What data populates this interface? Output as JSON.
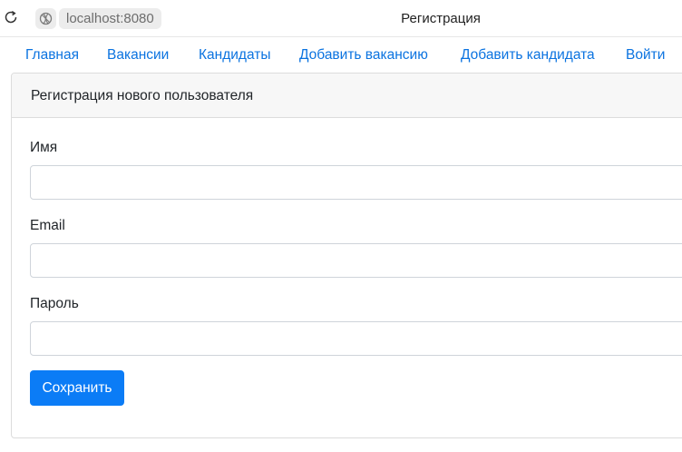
{
  "browser": {
    "url": "localhost:8080",
    "tab_title": "Регистрация"
  },
  "nav": {
    "items": [
      {
        "label": "Главная"
      },
      {
        "label": "Вакансии"
      },
      {
        "label": "Кандидаты"
      },
      {
        "label": "Добавить вакансию"
      },
      {
        "label": "Добавить кандидата"
      },
      {
        "label": "Войти"
      }
    ]
  },
  "form": {
    "title": "Регистрация нового пользователя",
    "fields": [
      {
        "label": "Имя",
        "value": ""
      },
      {
        "label": "Email",
        "value": ""
      },
      {
        "label": "Пароль",
        "value": ""
      }
    ],
    "submit_label": "Сохранить"
  },
  "colors": {
    "link": "#0b73e0",
    "primary_button": "#0b7cf6",
    "card_header_bg": "#f7f7f7"
  },
  "icons": [
    "reload-icon",
    "site-globe-icon"
  ]
}
